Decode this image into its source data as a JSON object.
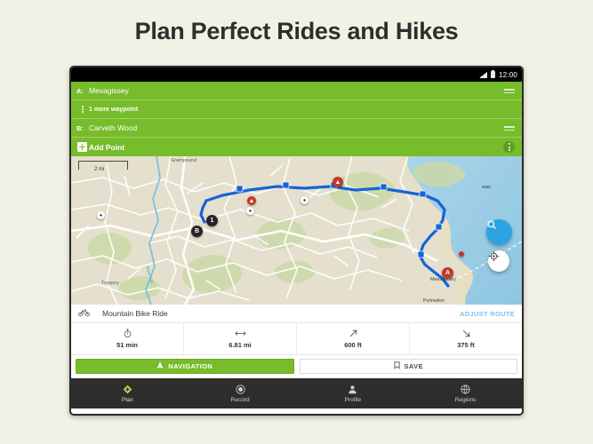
{
  "headline": "Plan Perfect Rides and Hikes",
  "status_bar": {
    "time": "12:00",
    "signal_icon": "signal-icon",
    "battery_icon": "battery-icon"
  },
  "waypoints": {
    "rows": [
      {
        "badge": "A:",
        "label": "Mevagissey",
        "type": "waypoint",
        "handle": "drag-handle-icon"
      },
      {
        "badge": "",
        "label": "1 more waypoint",
        "type": "collapsed",
        "handle": ""
      },
      {
        "badge": "B:",
        "label": "Carveth Wood",
        "type": "waypoint",
        "handle": "drag-handle-icon"
      },
      {
        "badge": "",
        "label": "Add Point",
        "type": "add",
        "handle": "overflow-menu-icon"
      }
    ],
    "accent_color": "#77bc2a"
  },
  "map": {
    "scale_label": "2 mi",
    "route_color": "#1565d8",
    "search_icon": "search-icon",
    "locate_icon": "locate-me-icon",
    "markers": [
      {
        "name": "waypoint-1",
        "label": "1"
      },
      {
        "name": "waypoint-b",
        "label": "B"
      },
      {
        "name": "waypoint-a",
        "label": "A"
      }
    ],
    "place_labels": [
      "Grampound",
      "Tregony",
      "River Fal",
      "Mevagissey",
      "Portmellon",
      "Pentewan"
    ]
  },
  "details": {
    "activity_icon": "mountain-bike-icon",
    "activity": "Mountain Bike Ride",
    "adjust_route": "ADJUST ROUTE",
    "adjust_route_color": "#7ec4e8",
    "stats": [
      {
        "name": "duration",
        "icon": "stopwatch-icon",
        "value": "51 min"
      },
      {
        "name": "distance",
        "icon": "distance-arrows-icon",
        "value": "6.81 mi"
      },
      {
        "name": "ascent",
        "icon": "arrow-up-right-icon",
        "value": "600 ft"
      },
      {
        "name": "descent",
        "icon": "arrow-down-right-icon",
        "value": "375 ft"
      }
    ],
    "navigation_button": "NAVIGATION",
    "navigation_icon": "navigation-arrow-icon",
    "save_button": "SAVE",
    "save_icon": "bookmark-icon"
  },
  "bottom_nav": {
    "items": [
      {
        "label": "Plan",
        "icon": "diamond-plan-icon",
        "active": true
      },
      {
        "label": "Record",
        "icon": "record-circle-icon",
        "active": false
      },
      {
        "label": "Profile",
        "icon": "person-icon",
        "active": false
      },
      {
        "label": "Regions",
        "icon": "globe-icon",
        "active": false
      }
    ],
    "active_color": "#b5d44f"
  }
}
